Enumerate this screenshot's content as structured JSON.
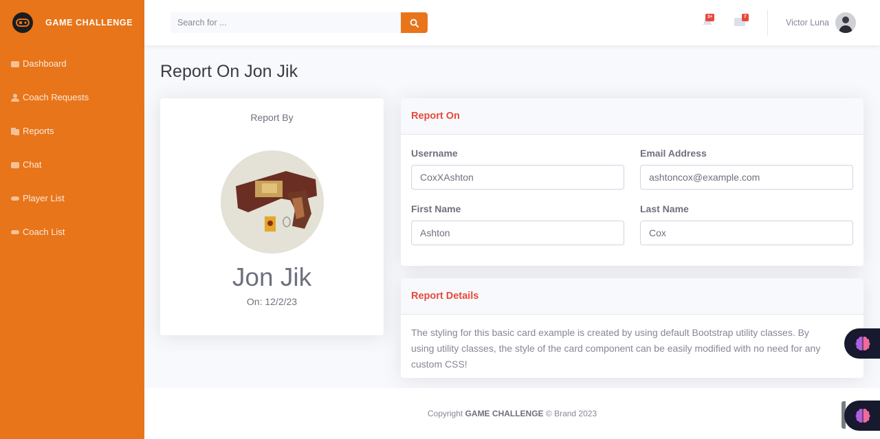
{
  "brand": {
    "name": "GAME CHALLENGE"
  },
  "sidebar": {
    "items": [
      {
        "label": "Dashboard",
        "icon": "dashboard-icon"
      },
      {
        "label": "Coach Requests",
        "icon": "user-icon"
      },
      {
        "label": "Reports",
        "icon": "reports-icon"
      },
      {
        "label": "Chat",
        "icon": "chat-icon"
      },
      {
        "label": "Player List",
        "icon": "gamepad-icon"
      },
      {
        "label": "Coach List",
        "icon": "gamepad-icon"
      }
    ]
  },
  "topbar": {
    "search_placeholder": "Search for ...",
    "alerts_badge": "3+",
    "messages_badge": "7",
    "user_name": "Victor Luna"
  },
  "page": {
    "title": "Report On Jon Jik"
  },
  "profile": {
    "report_by_label": "Report By",
    "name": "Jon Jik",
    "date": "On: 12/2/23"
  },
  "report_on": {
    "header": "Report On",
    "username_label": "Username",
    "username_value": "CoxXAshton",
    "email_label": "Email Address",
    "email_value": "ashtoncox@example.com",
    "first_name_label": "First Name",
    "first_name_value": "Ashton",
    "last_name_label": "Last Name",
    "last_name_value": "Cox"
  },
  "report_details": {
    "header": "Report Details",
    "line1": "The styling for this basic card example is created by using default Bootstrap utility classes. By",
    "line2": "using utility classes, the style of the card component can be easily modified with no need for any",
    "line3": "custom CSS!"
  },
  "footer": {
    "prefix": "Copyright ",
    "brand": "GAME CHALLENGE",
    "suffix": " © Brand 2023"
  },
  "colors": {
    "accent": "#e8751a",
    "danger": "#e74a3b",
    "float_bg": "#171a2e"
  }
}
